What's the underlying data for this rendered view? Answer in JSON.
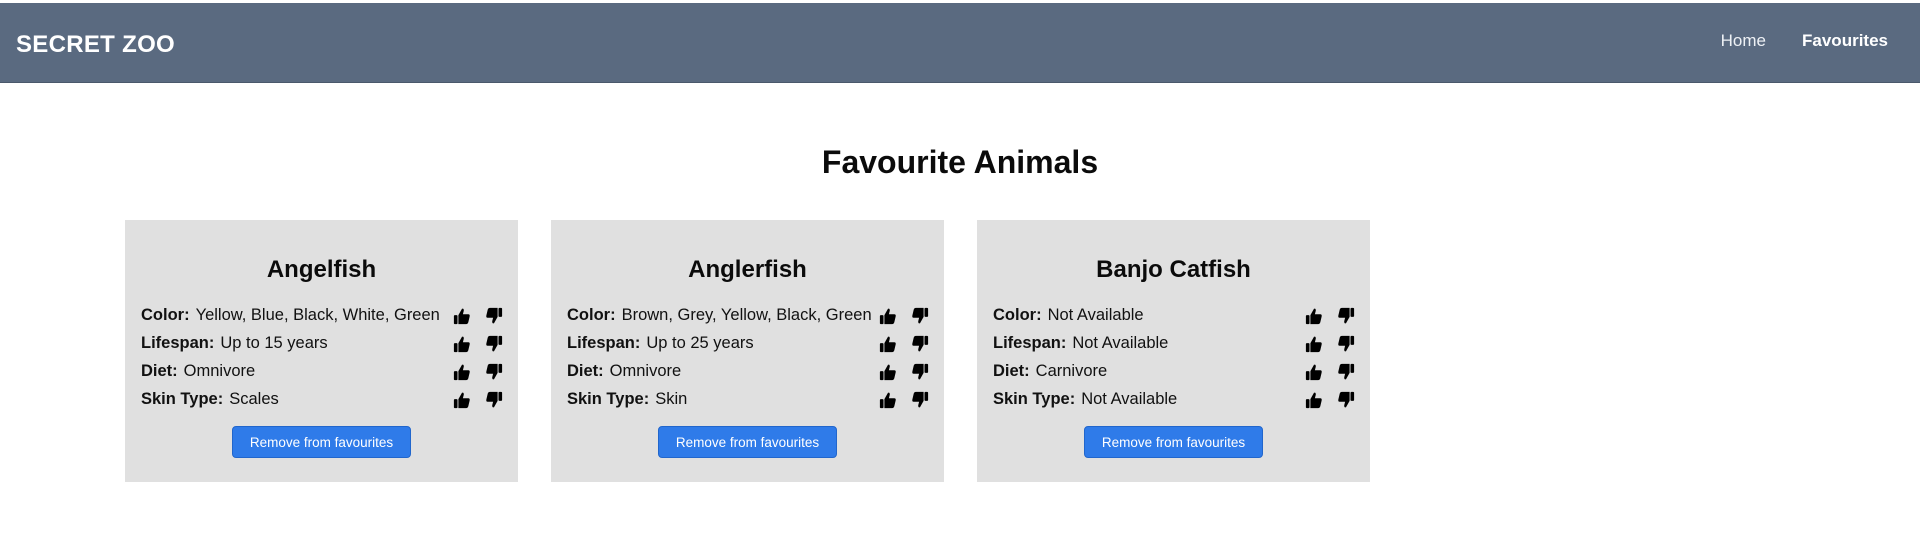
{
  "navbar": {
    "brand": "SECRET ZOO",
    "links": [
      {
        "label": "Home",
        "active": false
      },
      {
        "label": "Favourites",
        "active": true
      }
    ]
  },
  "page": {
    "title": "Favourite Animals"
  },
  "icons": {
    "up": "thumbs-up-icon",
    "down": "thumbs-down-icon"
  },
  "colors": {
    "navbar": "#5a6a80",
    "card": "#e0e0e0",
    "button": "#2f7be9"
  },
  "cards": [
    {
      "name": "Angelfish",
      "attributes": [
        {
          "label": "Color:",
          "value": "Yellow, Blue, Black, White, Green"
        },
        {
          "label": "Lifespan:",
          "value": "Up to 15 years"
        },
        {
          "label": "Diet:",
          "value": "Omnivore"
        },
        {
          "label": "Skin Type:",
          "value": "Scales"
        }
      ],
      "button": "Remove from favourites"
    },
    {
      "name": "Anglerfish",
      "attributes": [
        {
          "label": "Color:",
          "value": "Brown, Grey, Yellow, Black, Green"
        },
        {
          "label": "Lifespan:",
          "value": "Up to 25 years"
        },
        {
          "label": "Diet:",
          "value": "Omnivore"
        },
        {
          "label": "Skin Type:",
          "value": "Skin"
        }
      ],
      "button": "Remove from favourites"
    },
    {
      "name": "Banjo Catfish",
      "attributes": [
        {
          "label": "Color:",
          "value": "Not Available"
        },
        {
          "label": "Lifespan:",
          "value": "Not Available"
        },
        {
          "label": "Diet:",
          "value": "Carnivore"
        },
        {
          "label": "Skin Type:",
          "value": "Not Available"
        }
      ],
      "button": "Remove from favourites"
    }
  ]
}
